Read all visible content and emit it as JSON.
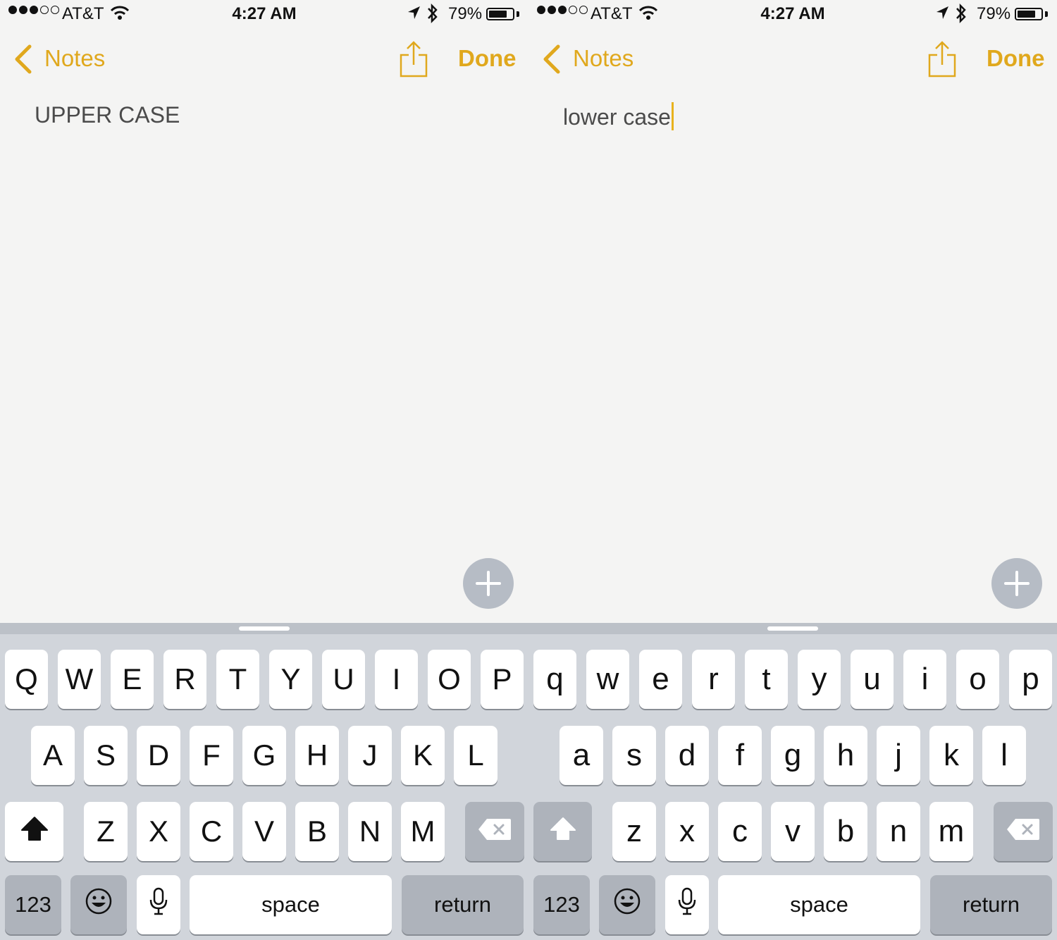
{
  "colors": {
    "accent": "#e0a81d",
    "cursor": "#e8b21c",
    "keyboard_bg": "#d1d5db",
    "fn_key": "#aeb3bb"
  },
  "panels": [
    {
      "status": {
        "carrier": "AT&T",
        "time": "4:27 AM",
        "battery": "79%",
        "signal_bars": 3,
        "battery_level": 0.79
      },
      "nav": {
        "back_label": "Notes",
        "done_label": "Done"
      },
      "note": {
        "text": "UPPER CASE",
        "show_cursor": false
      },
      "keyboard": {
        "row1": [
          "Q",
          "W",
          "E",
          "R",
          "T",
          "Y",
          "U",
          "I",
          "O",
          "P"
        ],
        "row2": [
          "A",
          "S",
          "D",
          "F",
          "G",
          "H",
          "J",
          "K",
          "L"
        ],
        "row3": [
          "Z",
          "X",
          "C",
          "V",
          "B",
          "N",
          "M"
        ],
        "shift_active": true,
        "numbers": "123",
        "space": "space",
        "return": "return"
      }
    },
    {
      "status": {
        "carrier": "AT&T",
        "time": "4:27 AM",
        "battery": "79%",
        "signal_bars": 3,
        "battery_level": 0.79
      },
      "nav": {
        "back_label": "Notes",
        "done_label": "Done"
      },
      "note": {
        "text": "lower case",
        "show_cursor": true
      },
      "keyboard": {
        "row1": [
          "q",
          "w",
          "e",
          "r",
          "t",
          "y",
          "u",
          "i",
          "o",
          "p"
        ],
        "row2": [
          "a",
          "s",
          "d",
          "f",
          "g",
          "h",
          "j",
          "k",
          "l"
        ],
        "row3": [
          "z",
          "x",
          "c",
          "v",
          "b",
          "n",
          "m"
        ],
        "shift_active": false,
        "numbers": "123",
        "space": "space",
        "return": "return"
      }
    }
  ]
}
